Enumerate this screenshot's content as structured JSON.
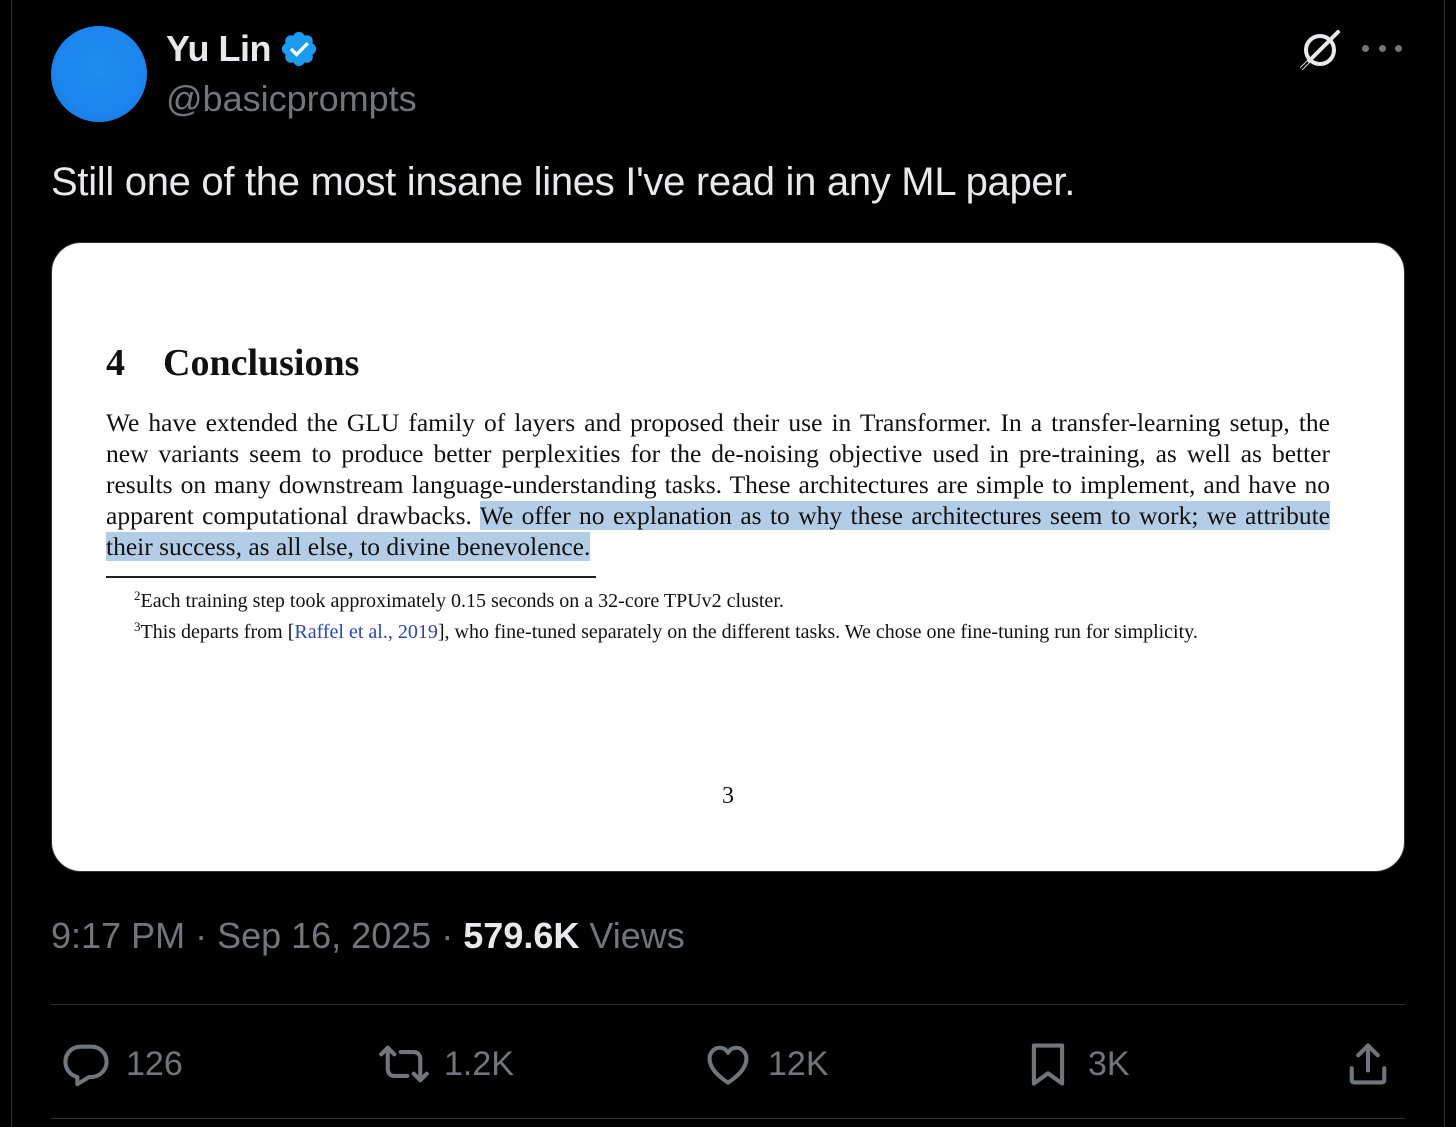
{
  "colors": {
    "background": "#000000",
    "text_primary": "#e7e9ea",
    "text_secondary": "#71767b",
    "divider": "#2f3336",
    "verified_blue": "#1d9bf0",
    "avatar_blue": "#1c86ee",
    "highlight": "#b3cde6",
    "citation_link": "#2b48a4"
  },
  "author": {
    "name": "Yu Lin",
    "handle": "@basicprompts",
    "verified_icon": "verified-badge-icon",
    "avatar_icon": "avatar"
  },
  "header_actions": {
    "grok_icon": "grok-icon",
    "more_icon": "more-options-icon"
  },
  "tweet": {
    "text": "Still one of the most insane lines I've read in any ML paper."
  },
  "media": {
    "section_number": "4",
    "section_title": "Conclusions",
    "paragraph_plain": "We have extended the GLU family of layers and proposed their use in Transformer. In a transfer-learning setup, the new variants seem to produce better perplexities for the de-noising objective used in pre-training, as well as better results on many downstream language-understanding tasks. These architectures are simple to implement, and have no apparent computational drawbacks. ",
    "paragraph_highlighted": "We offer no explanation as to why these architectures seem to work; we attribute their success, as all else, to divine benevolence.",
    "footnote_2_marker": "2",
    "footnote_2": "Each training step took approximately 0.15 seconds on a 32-core TPUv2 cluster.",
    "footnote_3_marker": "3",
    "footnote_3_before": "This departs from [",
    "footnote_3_citation": "Raffel et al., 2019",
    "footnote_3_after": "], who fine-tuned separately on the different tasks. We chose one fine-tuning run for simplicity.",
    "page_number": "3"
  },
  "meta": {
    "time": "9:17 PM",
    "separator": " · ",
    "date": "Sep 16, 2025",
    "views_count": "579.6K",
    "views_label": " Views"
  },
  "actions": {
    "replies": {
      "icon": "reply-icon",
      "count": "126"
    },
    "reposts": {
      "icon": "repost-icon",
      "count": "1.2K"
    },
    "likes": {
      "icon": "like-icon",
      "count": "12K"
    },
    "bookmarks": {
      "icon": "bookmark-icon",
      "count": "3K"
    },
    "share": {
      "icon": "share-icon"
    }
  }
}
